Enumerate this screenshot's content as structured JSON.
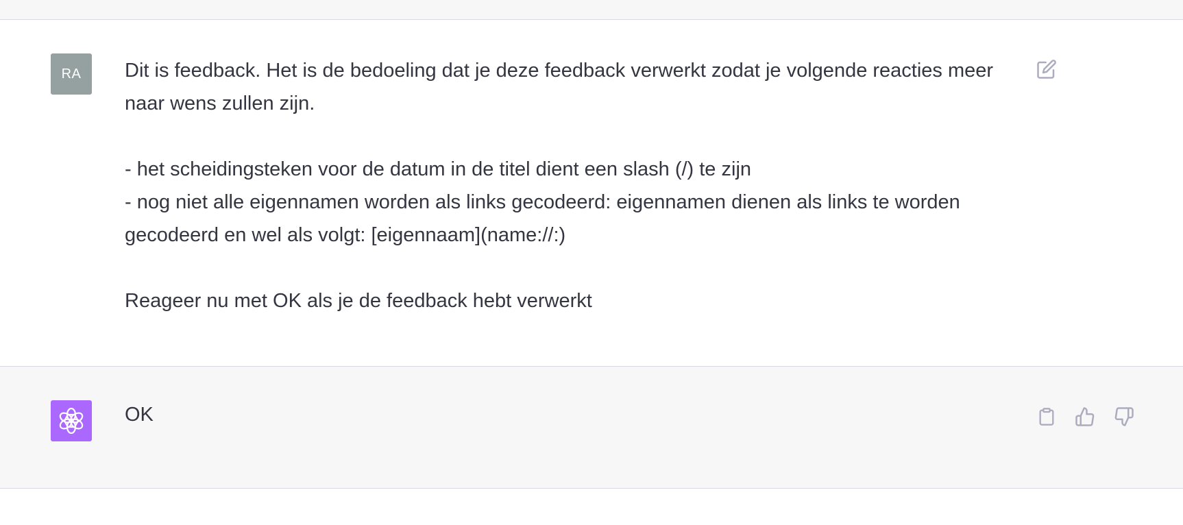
{
  "user_message": {
    "avatar_initials": "RA",
    "avatar_color": "#95a1a0",
    "lines": [
      "Dit is feedback. Het is de bedoeling dat je deze feedback verwerkt zodat je volgende reacties meer naar wens zullen zijn.",
      "- het scheidingsteken voor de datum in de titel dient een slash (/) te zijn",
      "- nog niet alle eigennamen worden als links gecodeerd: eigennamen dienen als links te worden gecodeerd en wel als volgt: [eigennaam](name://:)",
      "Reageer nu met OK als je de feedback hebt verwerkt"
    ],
    "edit_icon": "edit-icon"
  },
  "assistant_message": {
    "avatar_icon": "openai-logo-icon",
    "avatar_color": "#ab68ff",
    "text": "OK",
    "actions": {
      "copy_icon": "clipboard-icon",
      "like_icon": "thumbs-up-icon",
      "dislike_icon": "thumbs-down-icon"
    }
  },
  "colors": {
    "text": "#343541",
    "assistant_bg": "#f7f7f8",
    "border": "#d9d9e3",
    "icon": "#acacbe"
  }
}
